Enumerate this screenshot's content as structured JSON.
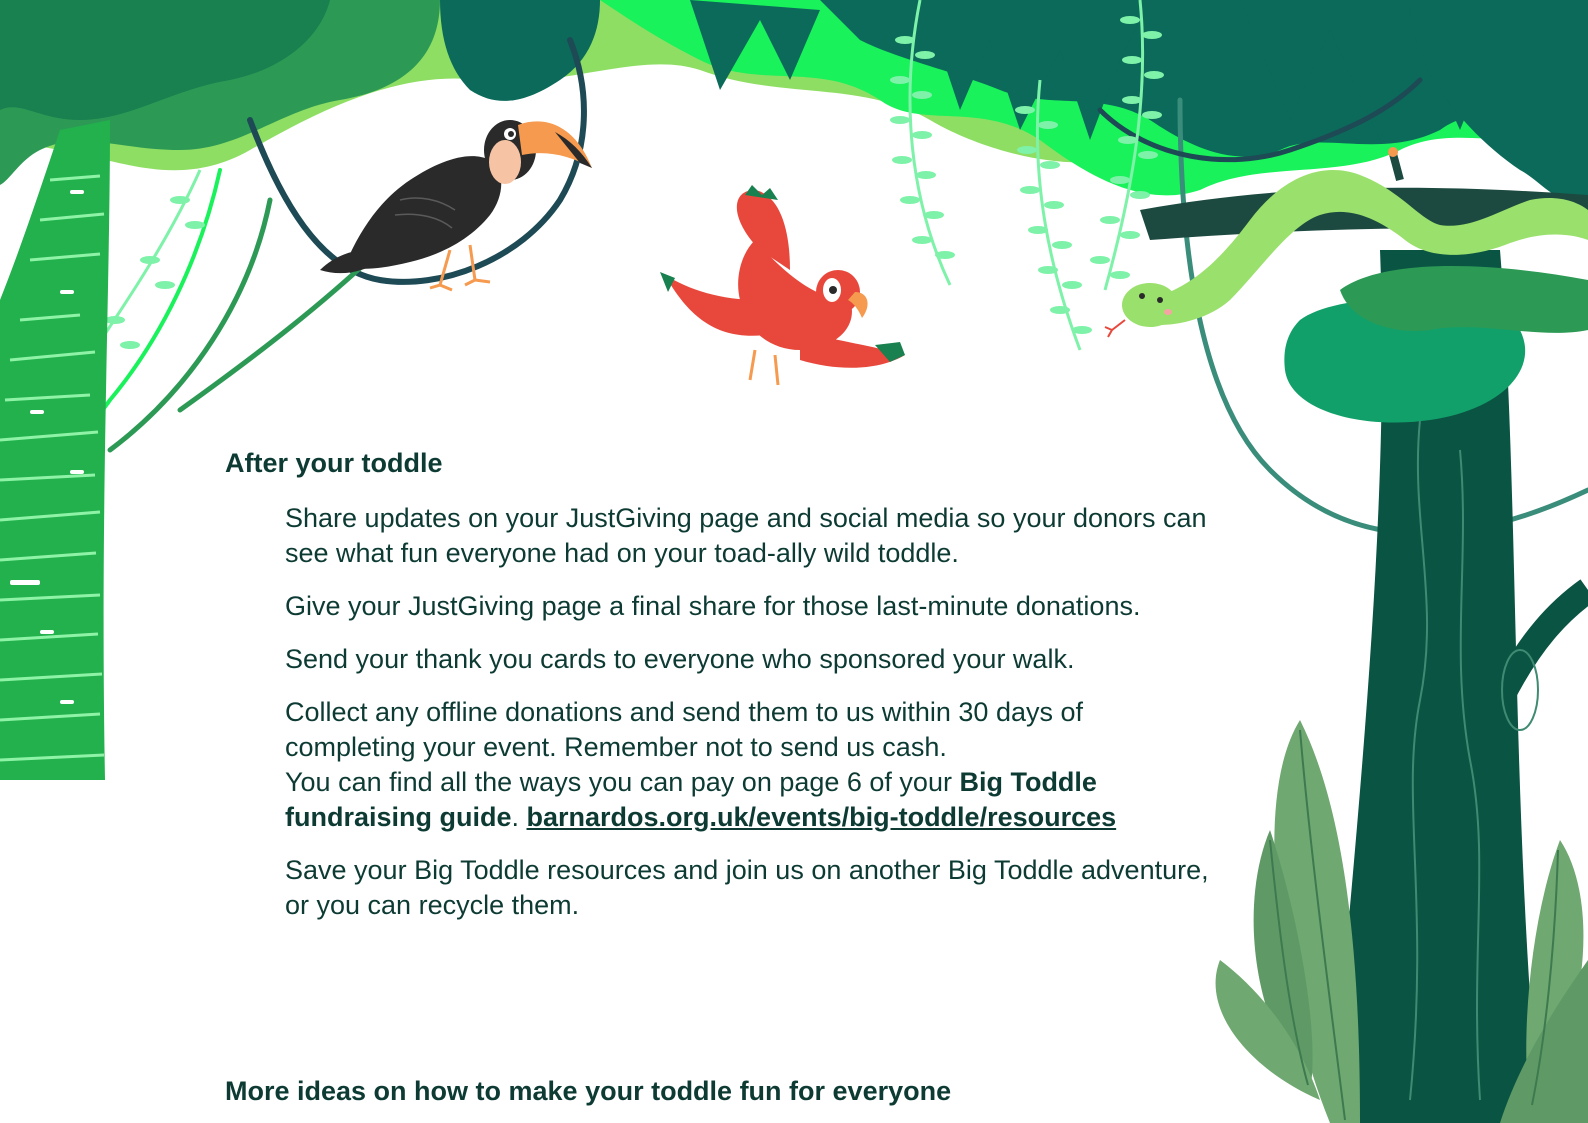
{
  "sections": {
    "after": {
      "heading": "After your toddle",
      "items": [
        "Share updates on your JustGiving page and social media so your donors can see what fun everyone had on your toad-ally wild toddle.",
        "Give your JustGiving page a final share for those last-minute donations.",
        "Send your thank you cards to everyone who sponsored your walk."
      ],
      "offline": {
        "line1": "Collect any offline donations and send them to us within 30 days of completing your event. Remember not to send us cash.",
        "line2_pre": "You can find all the ways you can pay on page 6 of your ",
        "guide": "Big Toddle fundraising guide",
        "period": ". ",
        "link": "barnardos.org.uk/events/big-toddle/resources"
      },
      "last": "Save your Big Toddle resources and join us on another Big Toddle adventure, or you can recycle them."
    },
    "more": {
      "heading": "More ideas on how to make your toddle fun for everyone"
    }
  },
  "colors": {
    "text": "#0d3b34",
    "leaf_light": "#8ede63",
    "leaf_bright": "#19f25a",
    "leaf_mid": "#2c9a55",
    "leaf_dark": "#0b6a5a",
    "trunk_dark": "#0a5443",
    "parrot": "#e8483c",
    "toucan": "#2a2a2a",
    "beak": "#f59a4e",
    "snake": "#9ae06c"
  },
  "illustrations": [
    "jungle-canopy",
    "tree-trunk-left",
    "tree-trunk-right",
    "toucan",
    "parrot",
    "snake",
    "vines",
    "fern-leaves"
  ]
}
